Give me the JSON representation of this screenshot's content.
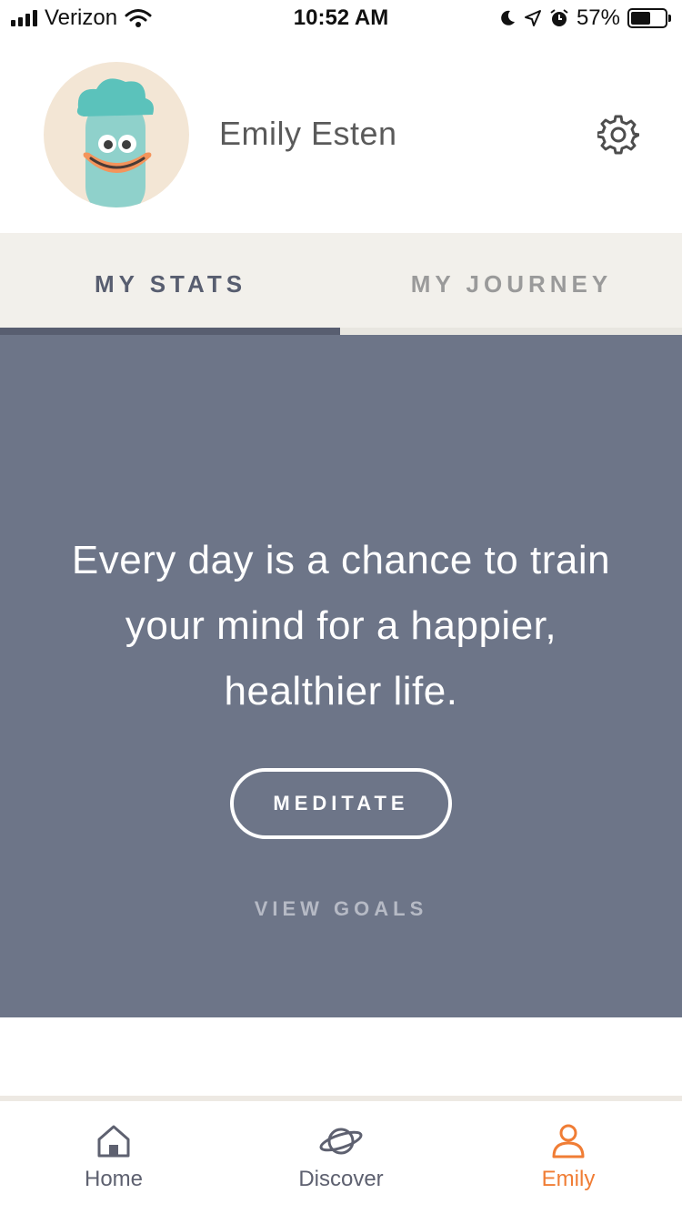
{
  "status_bar": {
    "carrier": "Verizon",
    "time": "10:52 AM",
    "battery_percent": "57%",
    "battery_level": 0.57,
    "icons": [
      "signal-icon",
      "wifi-icon",
      "moon-icon",
      "location-arrow-icon",
      "alarm-icon",
      "battery-icon"
    ]
  },
  "profile": {
    "name": "Emily Esten",
    "avatar_icon": "character-avatar",
    "settings_icon": "gear-icon"
  },
  "tabs": [
    {
      "label": "MY STATS",
      "active": true
    },
    {
      "label": "MY JOURNEY",
      "active": false
    }
  ],
  "main": {
    "quote": "Every day is a chance to train your mind for a happier, healthier life.",
    "meditate_label": "MEDITATE",
    "view_goals_label": "VIEW GOALS"
  },
  "tabbar": {
    "items": [
      {
        "label": "Home",
        "icon": "home-icon",
        "active": false
      },
      {
        "label": "Discover",
        "icon": "planet-icon",
        "active": false
      },
      {
        "label": "Emily",
        "icon": "person-icon",
        "active": true
      }
    ]
  },
  "colors": {
    "panel_bg": "#6d7588",
    "tabs_bg": "#f2f0eb",
    "active_tab": "#585e70",
    "accent_orange": "#f07d35",
    "avatar_bg": "#f3e6d5"
  }
}
